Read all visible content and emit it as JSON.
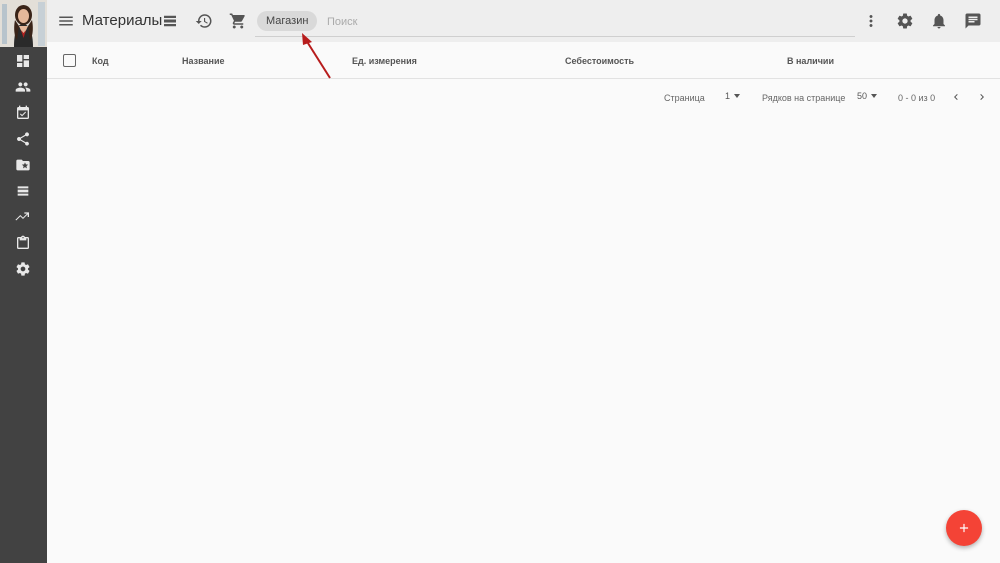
{
  "header": {
    "title": "Материалы",
    "chip_label": "Магазин",
    "search_placeholder": "Поиск"
  },
  "table": {
    "columns": [
      "Код",
      "Название",
      "Ед. измерения",
      "Себестоимость",
      "В наличии"
    ]
  },
  "pagination": {
    "page_label": "Страница",
    "page_value": "1",
    "rows_label": "Рядков на странице",
    "rows_value": "50",
    "range_text": "0 - 0 из 0"
  },
  "colors": {
    "sidebar": "#424242",
    "fab": "#f44336",
    "annotation_arrow": "#b71c1c"
  },
  "icons": {
    "sidebar": [
      "dashboard-icon",
      "people-icon",
      "event-available-icon",
      "share-icon",
      "folder-special-icon",
      "list-icon",
      "trending-icon",
      "assignment-icon",
      "settings-icon"
    ],
    "topbar": [
      "menu-icon",
      "list-view-icon",
      "history-icon",
      "cart-icon",
      "more-vert-icon",
      "settings-icon",
      "bell-icon",
      "chat-icon"
    ]
  }
}
